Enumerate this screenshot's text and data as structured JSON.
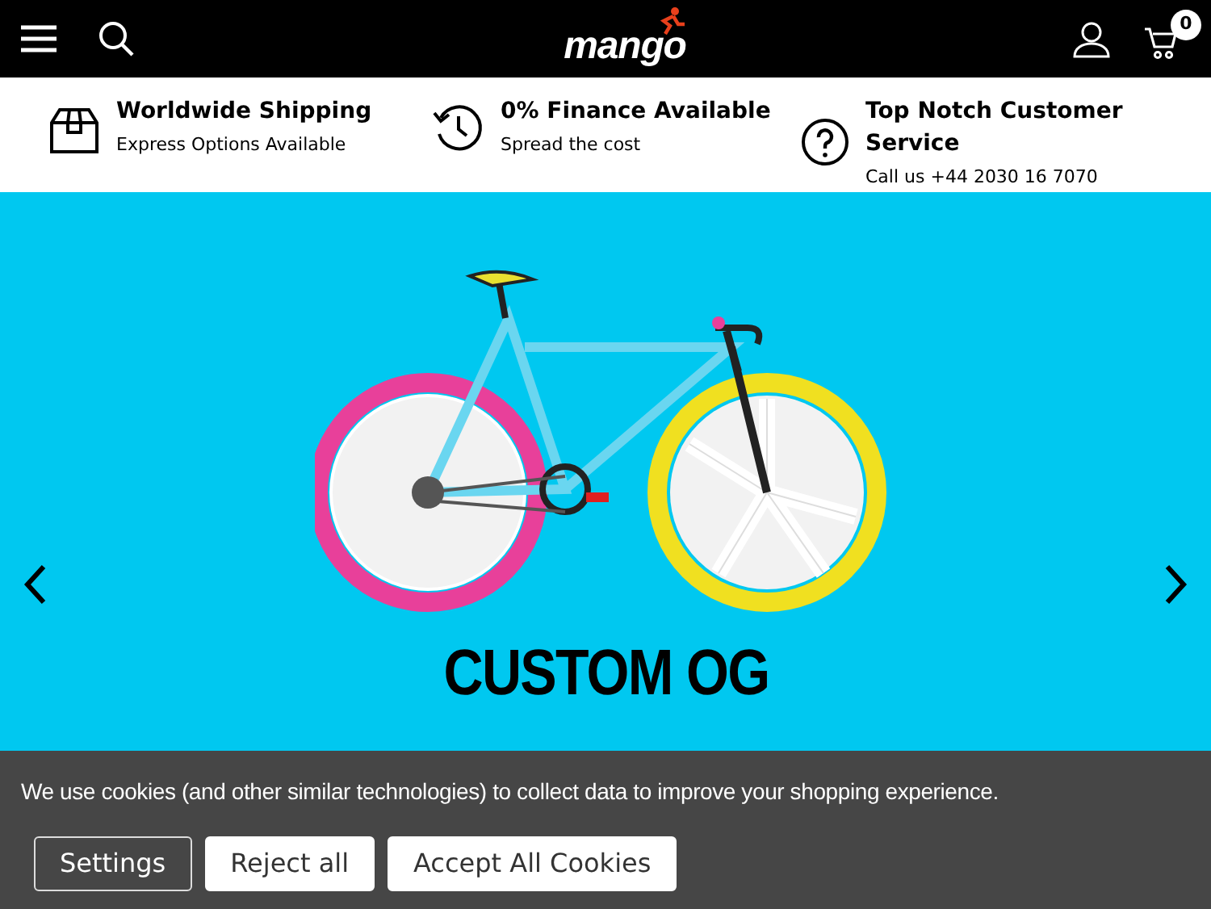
{
  "header": {
    "logo": "mango",
    "cart_count": "0"
  },
  "features": [
    {
      "kind": "box",
      "title": "Worldwide Shipping",
      "subtitle": "Express Options Available"
    },
    {
      "kind": "history",
      "title": "0% Finance Available",
      "subtitle": "Spread the cost"
    },
    {
      "kind": "help",
      "title": "Top Notch Customer Service",
      "subtitle": "Call us +44 2030 16 7070"
    }
  ],
  "hero": {
    "title": "CUSTOM OG"
  },
  "cookie_banner": {
    "message": "We use cookies (and other similar technologies) to collect data to improve your shopping experience.",
    "buttons": [
      {
        "label": "Settings",
        "kind": "outline"
      },
      {
        "label": "Reject all",
        "kind": "solid"
      },
      {
        "label": "Accept All Cookies",
        "kind": "solid"
      }
    ]
  }
}
